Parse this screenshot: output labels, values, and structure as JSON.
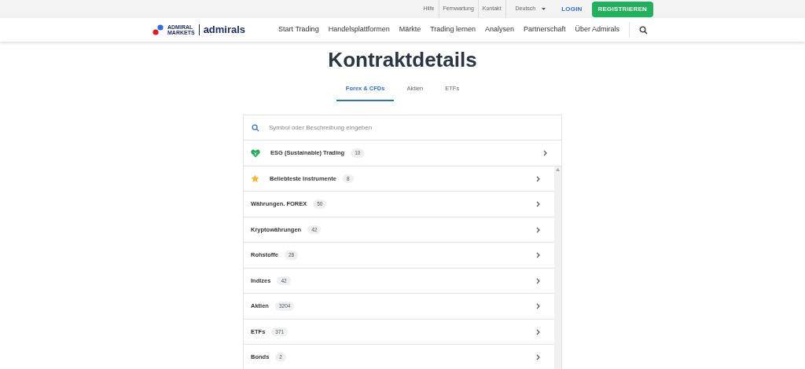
{
  "top_bar": {
    "links": [
      "Hilfe",
      "Fernwartung",
      "Kontakt"
    ],
    "language": "Deutsch",
    "login": "LOGIN",
    "register": "REGISTRIEREN"
  },
  "logo": {
    "line_1": "ADMIRAL",
    "line_2": "MARKETS",
    "brand": "admirals"
  },
  "nav": [
    "Start Trading",
    "Handelsplattformen",
    "Märkte",
    "Trading lernen",
    "Analysen",
    "Partnerschaft",
    "Über Admirals"
  ],
  "title": "Kontraktdetails",
  "tabs": [
    {
      "label": "Forex & CFDs",
      "selected": true
    },
    {
      "label": "Aktien",
      "selected": false
    },
    {
      "label": "ETFs",
      "selected": false
    }
  ],
  "search": {
    "placeholder": "Symbol oder Beschreibung eingeben"
  },
  "featured": {
    "kind": "esg",
    "label": "ESG (Sustainable) Trading",
    "count": "10"
  },
  "categories": [
    {
      "kind": "favorite",
      "label": "Beliebteste Instrumente",
      "count": "8"
    },
    {
      "kind": "plain",
      "label": "Währungen. FOREX",
      "count": "50"
    },
    {
      "kind": "plain",
      "label": "Kryptowährungen",
      "count": "42"
    },
    {
      "kind": "plain",
      "label": "Rohstoffe",
      "count": "28"
    },
    {
      "kind": "plain",
      "label": "Indizes",
      "count": "42"
    },
    {
      "kind": "plain",
      "label": "Aktien",
      "count": "3204"
    },
    {
      "kind": "plain",
      "label": "ETFs",
      "count": "371"
    },
    {
      "kind": "plain",
      "label": "Bonds",
      "count": "2"
    }
  ]
}
